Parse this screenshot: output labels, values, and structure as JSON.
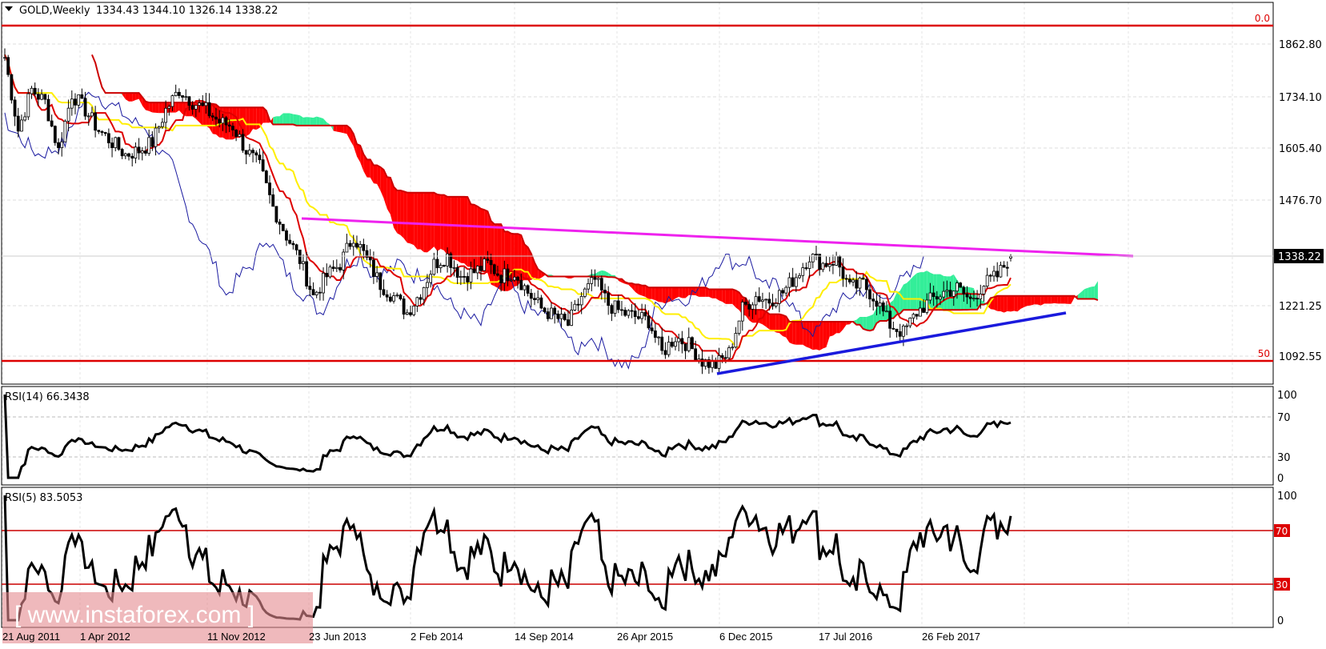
{
  "header": {
    "symbol_label": "GOLD,Weekly",
    "ohlc": "1334.43 1344.10 1326.14 1338.22"
  },
  "colors": {
    "bull_cloud": "#33ee99",
    "bear_cloud": "#ff0000",
    "tenkan": "#dd0000",
    "kijun": "#ffee00",
    "chikou": "#1a1aa0",
    "resistance": "#ee22ee",
    "support": "#1a1add",
    "fib": "#dd0000"
  },
  "watermark": "[ www.instaforex.com ]",
  "chart_data": [
    {
      "type": "candlestick",
      "title": "GOLD,Weekly",
      "timeframe": "Weekly",
      "last_ohlc": {
        "open": 1334.43,
        "high": 1344.1,
        "low": 1326.14,
        "close": 1338.22
      },
      "current_price_label": "1338.22",
      "y_ticks": [
        "1862.80",
        "1734.10",
        "1605.40",
        "1476.70",
        "1221.25",
        "1092.55"
      ],
      "ylim": [
        1040,
        1920
      ],
      "x_ticks": [
        "21 Aug 2011",
        "1 Apr 2012",
        "11 Nov 2012",
        "23 Jun 2013",
        "2 Feb 2014",
        "14 Sep 2014",
        "26 Apr 2015",
        "6 Dec 2015",
        "17 Jul 2016",
        "26 Feb 2017"
      ],
      "fib_levels": [
        {
          "label": "0.0",
          "price": 1920
        },
        {
          "label": "50",
          "price": 1085
        }
      ],
      "indicators": [
        "Ichimoku Kinko Hyo"
      ],
      "approx_close_every_4_weeks": [
        1830,
        1650,
        1750,
        1720,
        1600,
        1740,
        1700,
        1650,
        1620,
        1590,
        1600,
        1620,
        1700,
        1750,
        1720,
        1700,
        1670,
        1660,
        1600,
        1560,
        1460,
        1390,
        1330,
        1240,
        1290,
        1320,
        1390,
        1330,
        1270,
        1240,
        1200,
        1250,
        1320,
        1340,
        1290,
        1300,
        1320,
        1290,
        1300,
        1250,
        1210,
        1190,
        1170,
        1240,
        1280,
        1220,
        1200,
        1190,
        1180,
        1100,
        1140,
        1120,
        1080,
        1070,
        1100,
        1210,
        1240,
        1230,
        1250,
        1290,
        1340,
        1320,
        1330,
        1260,
        1270,
        1230,
        1170,
        1150,
        1200,
        1230,
        1250,
        1260,
        1230,
        1270,
        1290,
        1338
      ],
      "trendlines": [
        {
          "name": "resistance",
          "from": {
            "date": "Jun 2013",
            "price": 1420
          },
          "to": {
            "date": "late 2017",
            "price": 1365
          }
        },
        {
          "name": "support",
          "from": {
            "date": "Dec 2015",
            "price": 1050
          },
          "to": {
            "date": "mid 2017",
            "price": 1200
          }
        }
      ]
    },
    {
      "type": "line",
      "title": "RSI(14)",
      "label": "RSI(14) 66.3438",
      "last_value": 66.3438,
      "y_ticks": [
        "100",
        "70",
        "30",
        "0"
      ],
      "ylim": [
        0,
        100
      ]
    },
    {
      "type": "line",
      "title": "RSI(5)",
      "label": "RSI(5) 83.5053",
      "last_value": 83.5053,
      "y_ticks": [
        "100",
        "0"
      ],
      "levels": [
        "70",
        "30"
      ],
      "ylim": [
        0,
        100
      ]
    }
  ]
}
